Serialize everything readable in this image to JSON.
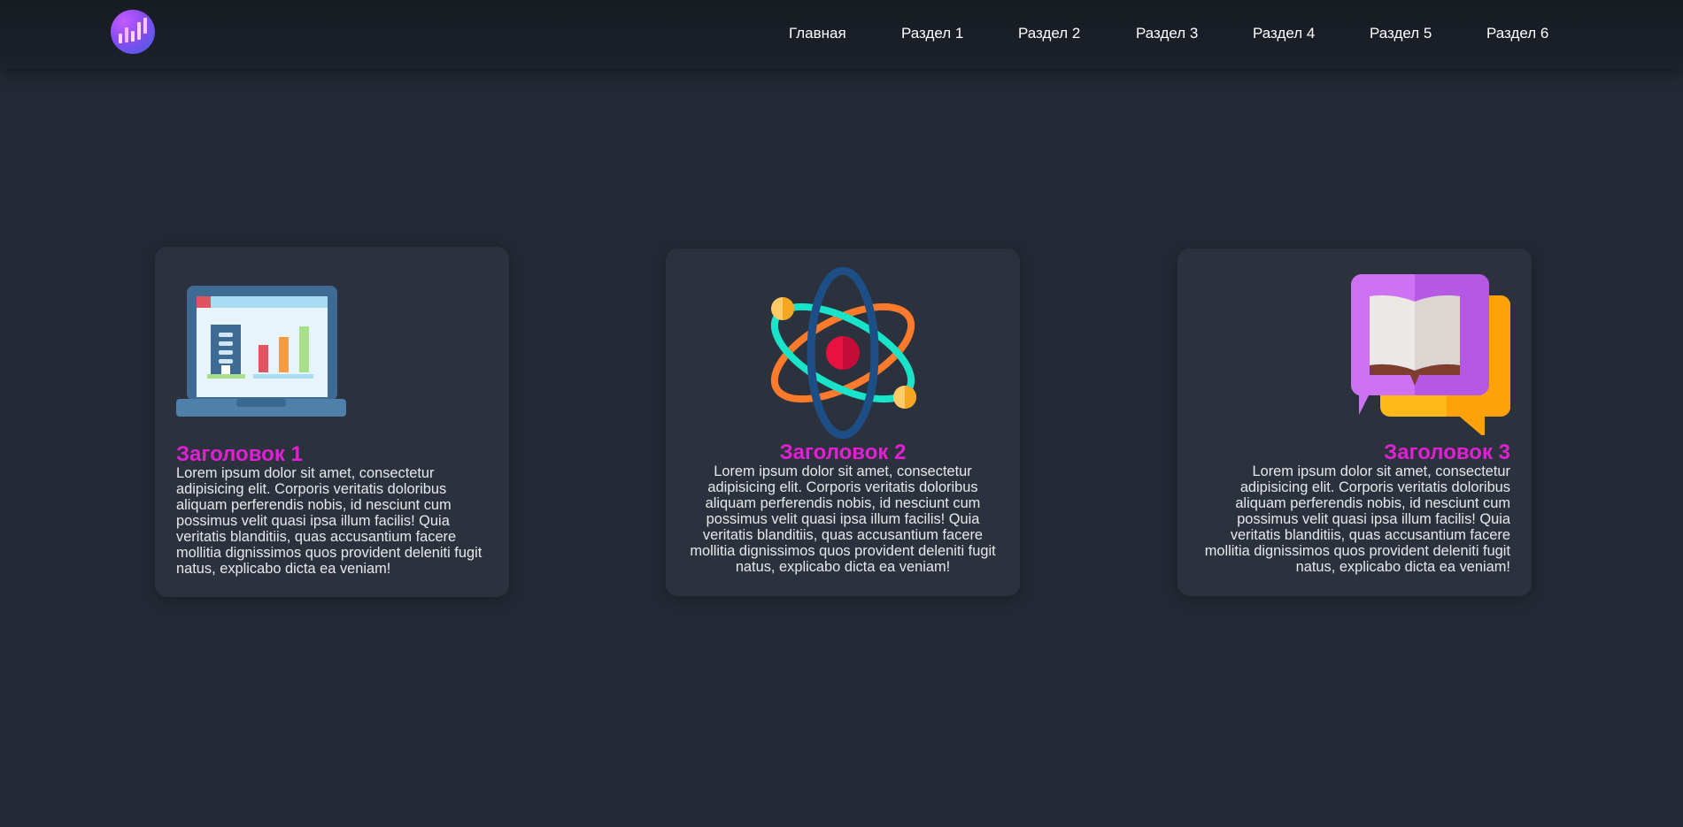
{
  "header": {
    "logo": {
      "icon": "chart-logo-icon",
      "colors": [
        "#c25bff",
        "#3f5fe6"
      ]
    },
    "nav": [
      {
        "label": "Главная"
      },
      {
        "label": "Раздел 1"
      },
      {
        "label": "Раздел 2"
      },
      {
        "label": "Раздел 3"
      },
      {
        "label": "Раздел 4"
      },
      {
        "label": "Раздел 5"
      },
      {
        "label": "Раздел 6"
      }
    ]
  },
  "cards": [
    {
      "icon": "laptop-chart-icon",
      "align": "left",
      "title": "Заголовок 1",
      "text": "Lorem ipsum dolor sit amet, consectetur adipisicing elit. Corporis veritatis doloribus aliquam perferendis nobis, id nesciunt cum possimus velit quasi ipsa illum facilis! Quia veritatis blanditiis, quas accusantium facere mollitia dignissimos quos provident deleniti fugit natus, explicabo dicta ea veniam!"
    },
    {
      "icon": "atom-icon",
      "align": "center",
      "title": "Заголовок 2",
      "text": "Lorem ipsum dolor sit amet, consectetur adipisicing elit. Corporis veritatis doloribus aliquam perferendis nobis, id nesciunt cum possimus velit quasi ipsa illum facilis! Quia veritatis blanditiis, quas accusantium facere mollitia dignissimos quos provident deleniti fugit natus, explicabo dicta ea veniam!"
    },
    {
      "icon": "book-chat-icon",
      "align": "right",
      "title": "Заголовок 3",
      "text": "Lorem ipsum dolor sit amet, consectetur adipisicing elit. Corporis veritatis doloribus aliquam perferendis nobis, id nesciunt cum possimus velit quasi ipsa illum facilis! Quia veritatis blanditiis, quas accusantium facere mollitia dignissimos quos provident deleniti fugit natus, explicabo dicta ea veniam!"
    }
  ],
  "colors": {
    "background": "#232934",
    "header": "#1a1e26",
    "card": "#2c323d",
    "title_accent": "#e11fd4",
    "text": "#e8e8ea"
  }
}
